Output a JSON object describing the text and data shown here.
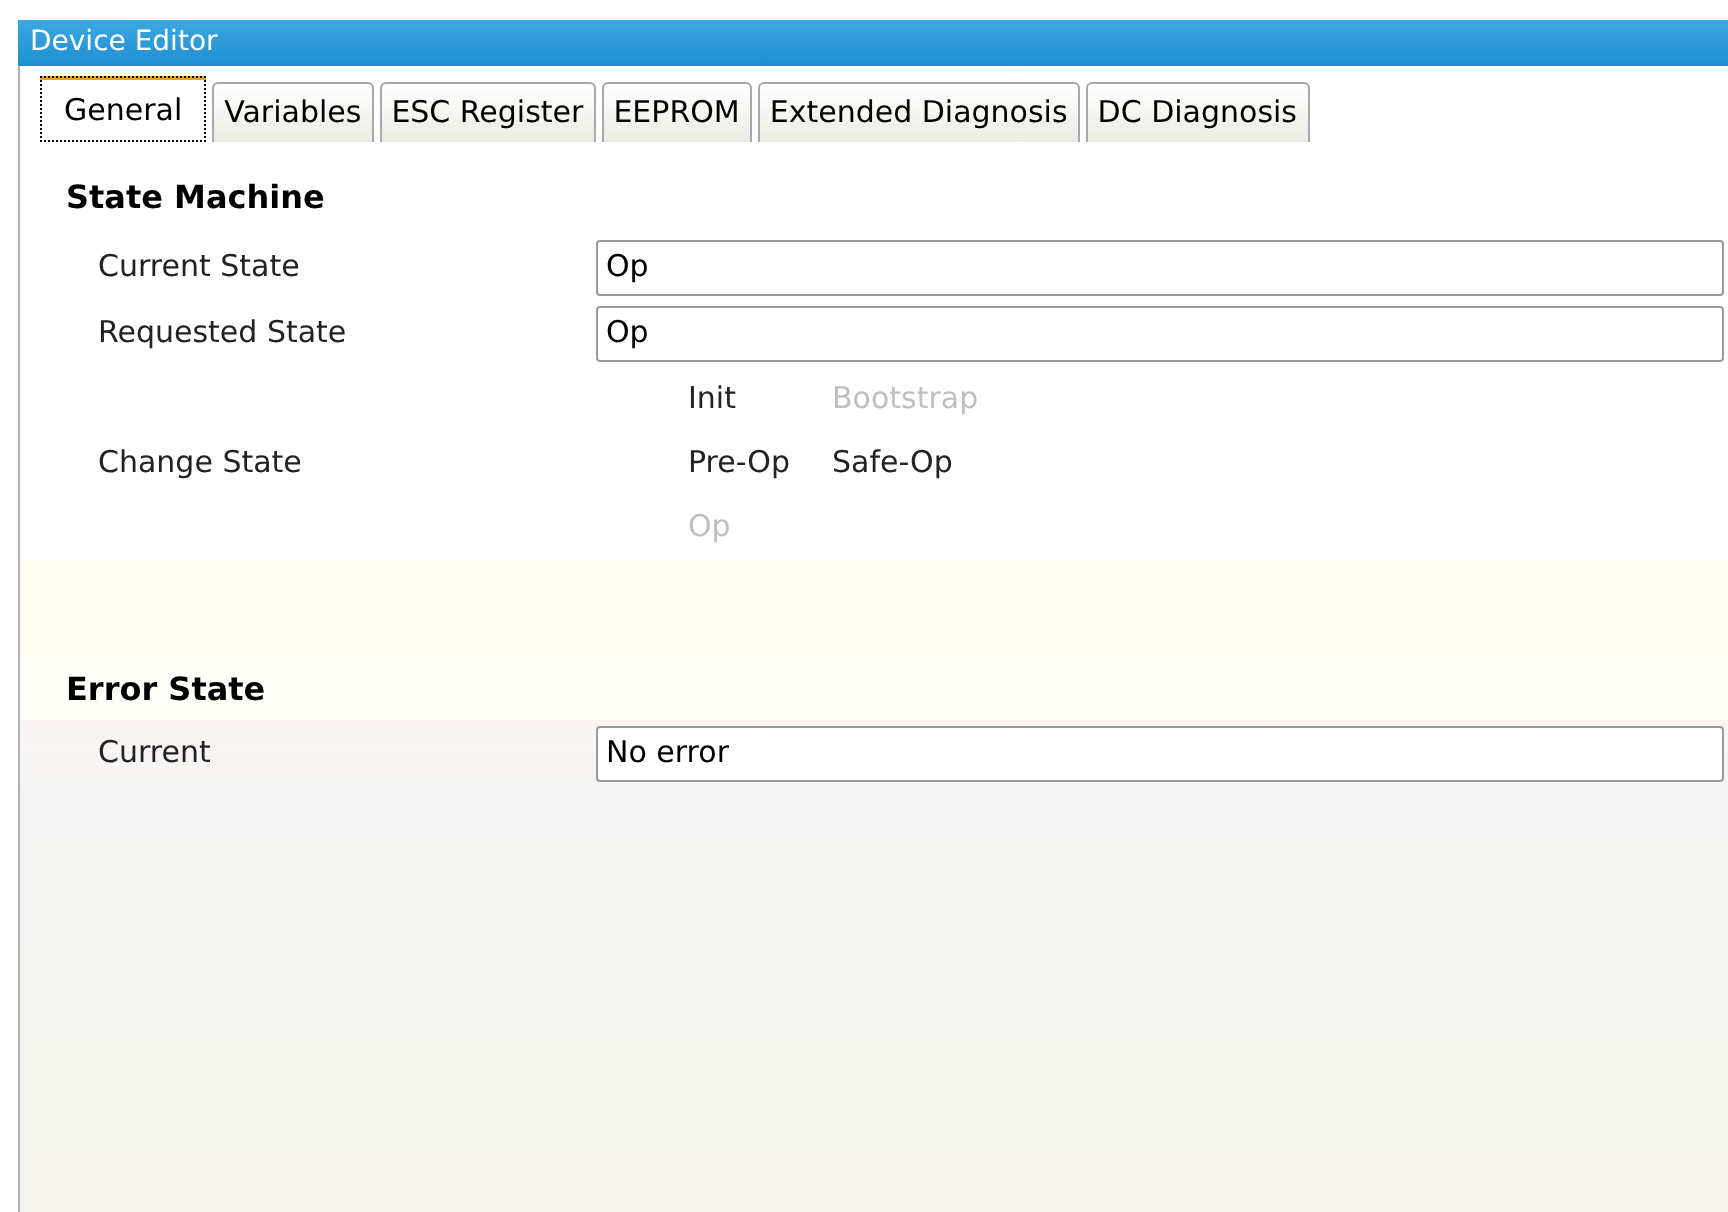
{
  "window": {
    "title": "Device Editor"
  },
  "tabs": [
    {
      "label": "General",
      "selected": true
    },
    {
      "label": "Variables",
      "selected": false
    },
    {
      "label": "ESC Register",
      "selected": false
    },
    {
      "label": "EEPROM",
      "selected": false
    },
    {
      "label": "Extended Diagnosis",
      "selected": false
    },
    {
      "label": "DC Diagnosis",
      "selected": false
    }
  ],
  "state_machine": {
    "heading": "State Machine",
    "fields": [
      {
        "label": "Current State",
        "value": "Op"
      },
      {
        "label": "Requested State",
        "value": "Op"
      }
    ],
    "change_state": {
      "label": "Change State",
      "buttons": [
        {
          "label": "Init",
          "disabled": false
        },
        {
          "label": "Bootstrap",
          "disabled": true
        },
        {
          "label": "Pre-Op",
          "disabled": false
        },
        {
          "label": "Safe-Op",
          "disabled": false
        },
        {
          "label": "Op",
          "disabled": true
        }
      ]
    }
  },
  "error_state": {
    "heading": "Error State",
    "fields": [
      {
        "label": "Current",
        "value": "No error"
      }
    ]
  }
}
